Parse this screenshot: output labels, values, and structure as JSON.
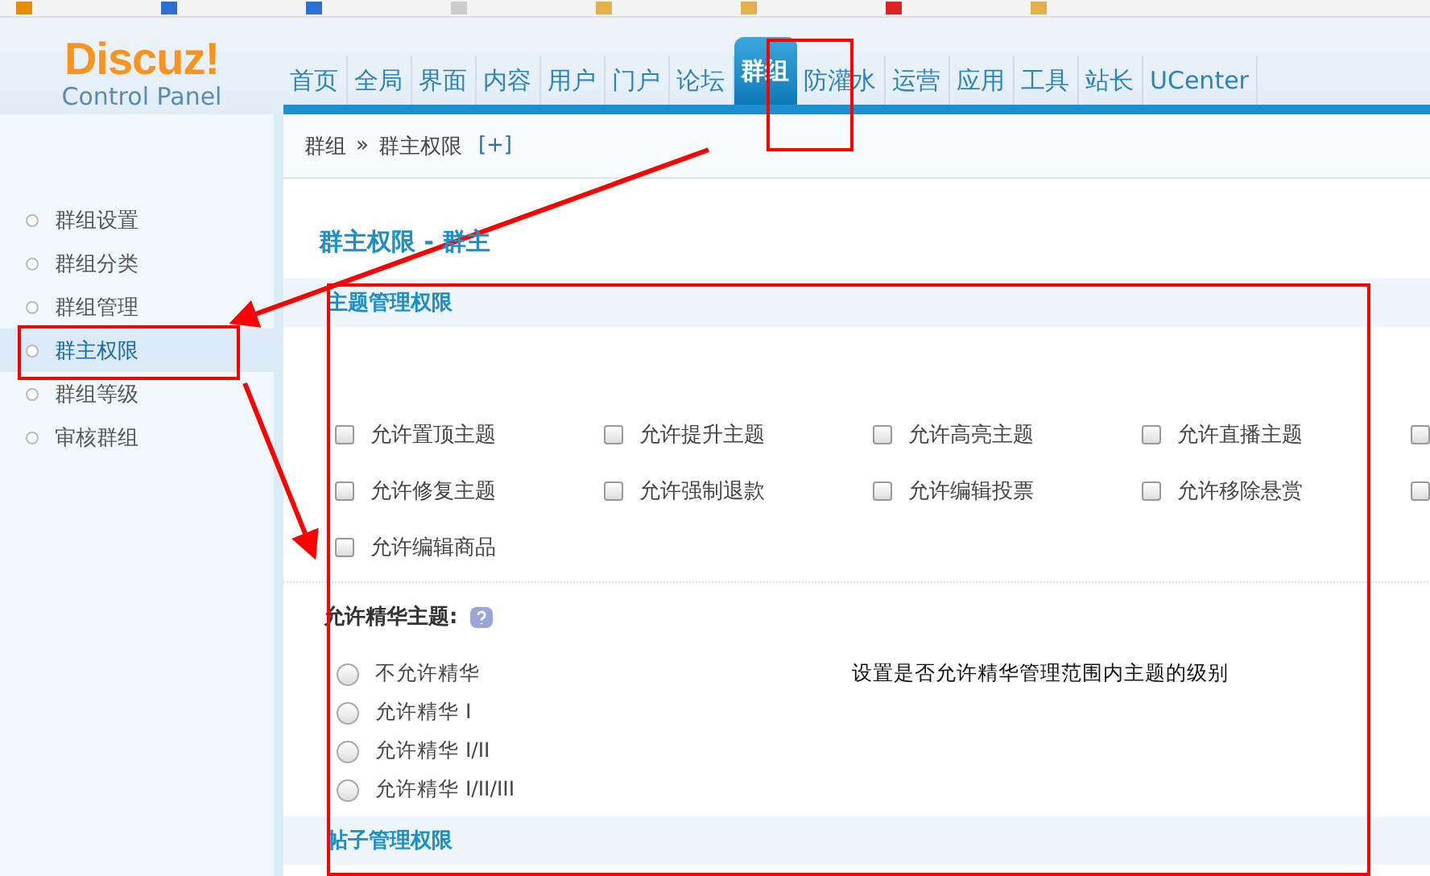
{
  "logo": {
    "title": "Discuz!",
    "subtitle": "Control Panel"
  },
  "nav": [
    {
      "label": "首页",
      "selected": false
    },
    {
      "label": "全局",
      "selected": false
    },
    {
      "label": "界面",
      "selected": false
    },
    {
      "label": "内容",
      "selected": false
    },
    {
      "label": "用户",
      "selected": false
    },
    {
      "label": "门户",
      "selected": false
    },
    {
      "label": "论坛",
      "selected": false
    },
    {
      "label": "群组",
      "selected": true
    },
    {
      "label": "防灌水",
      "selected": false
    },
    {
      "label": "运营",
      "selected": false
    },
    {
      "label": "应用",
      "selected": false
    },
    {
      "label": "工具",
      "selected": false
    },
    {
      "label": "站长",
      "selected": false
    },
    {
      "label": "UCenter",
      "selected": false
    }
  ],
  "breadcrumb": {
    "items": [
      "群组",
      "群主权限"
    ],
    "separator": "»",
    "add": "[+]"
  },
  "sidebar": {
    "items": [
      {
        "label": "群组设置",
        "selected": false
      },
      {
        "label": "群组分类",
        "selected": false
      },
      {
        "label": "群组管理",
        "selected": false
      },
      {
        "label": "群主权限",
        "selected": true
      },
      {
        "label": "群组等级",
        "selected": false
      },
      {
        "label": "审核群组",
        "selected": false
      }
    ]
  },
  "page_title": "群主权限 - 群主",
  "sections": [
    {
      "title": "主题管理权限"
    },
    {
      "title": "帖子管理权限"
    }
  ],
  "permissions": [
    [
      {
        "label": "允许置顶主题",
        "checked": false
      },
      {
        "label": "允许提升主题",
        "checked": false
      },
      {
        "label": "允许高亮主题",
        "checked": false
      },
      {
        "label": "允许直播主题",
        "checked": false
      },
      {
        "checked": false
      }
    ],
    [
      {
        "label": "允许修复主题",
        "checked": false
      },
      {
        "label": "允许强制退款",
        "checked": false
      },
      {
        "label": "允许编辑投票",
        "checked": false
      },
      {
        "label": "允许移除悬赏",
        "checked": false
      },
      {
        "checked": false
      }
    ],
    [
      {
        "label": "允许编辑商品",
        "checked": false
      }
    ]
  ],
  "digest": {
    "label": "允许精华主题:",
    "description": "设置是否允许精华管理范围内主题的级别",
    "options": [
      {
        "label": "不允许精华",
        "selected": false
      },
      {
        "label": "允许精华 I",
        "selected": false
      },
      {
        "label": "允许精华 I/II",
        "selected": false
      },
      {
        "label": "允许精华 I/II/III",
        "selected": false
      }
    ]
  }
}
